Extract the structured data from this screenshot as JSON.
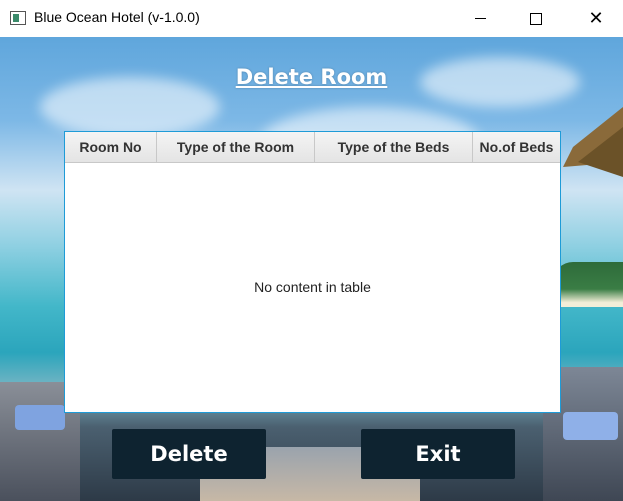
{
  "window": {
    "title": "Blue Ocean Hotel (v-1.0.0)",
    "controls": [
      "minimize-icon",
      "maximize-icon",
      "close-icon"
    ]
  },
  "page": {
    "heading": "Delete Room"
  },
  "table": {
    "columns": [
      "Room No",
      "Type of the Room",
      "Type of the Beds",
      "No.of Beds"
    ],
    "rows": [],
    "empty_message": "No content in table",
    "border_color": "#1e9bd7"
  },
  "buttons": {
    "delete_label": "Delete",
    "exit_label": "Exit",
    "color": "#0e2330"
  }
}
